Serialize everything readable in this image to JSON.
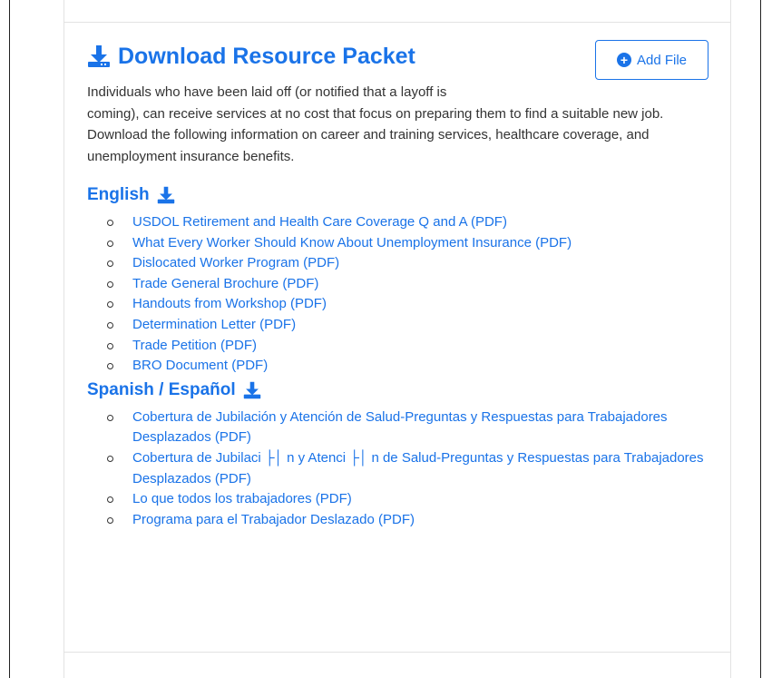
{
  "header": {
    "title": "Download Resource Packet",
    "add_file_label": "Add File",
    "description_line1": "Individuals who have been laid off (or notified that a layoff is",
    "description_rest": "coming), can receive services at no cost that focus on preparing them to find a suitable new job. Download the following information on career and training services, healthcare coverage, and unemployment insurance benefits."
  },
  "english": {
    "heading": "English",
    "items": [
      "USDOL Retirement and Health Care Coverage Q and A (PDF)",
      "What Every Worker Should Know About Unemployment Insurance (PDF)",
      "Dislocated Worker Program (PDF)",
      "Trade General Brochure (PDF)",
      "Handouts from Workshop (PDF)",
      "Determination Letter (PDF)",
      "Trade Petition (PDF)",
      "BRO Document (PDF)"
    ]
  },
  "spanish": {
    "heading": "Spanish / Español",
    "items": [
      "Cobertura de Jubilación y Atención de Salud-Preguntas y Respuestas para Trabajadores Desplazados (PDF)",
      "Cobertura de Jubilaci ├│ n y Atenci ├│ n de Salud-Preguntas y Respuestas para Trabajadores Desplazados (PDF)",
      "Lo que todos los trabajadores (PDF)",
      "Programa para el Trabajador Deslazado (PDF)"
    ]
  },
  "colors": {
    "accent": "#1a73e8",
    "text": "#333333",
    "border": "#e2e2e2"
  },
  "icons": {
    "title_icon": "download-icon",
    "english_icon": "download-icon",
    "spanish_icon": "download-icon",
    "add_file_icon": "plus-circle-icon"
  }
}
